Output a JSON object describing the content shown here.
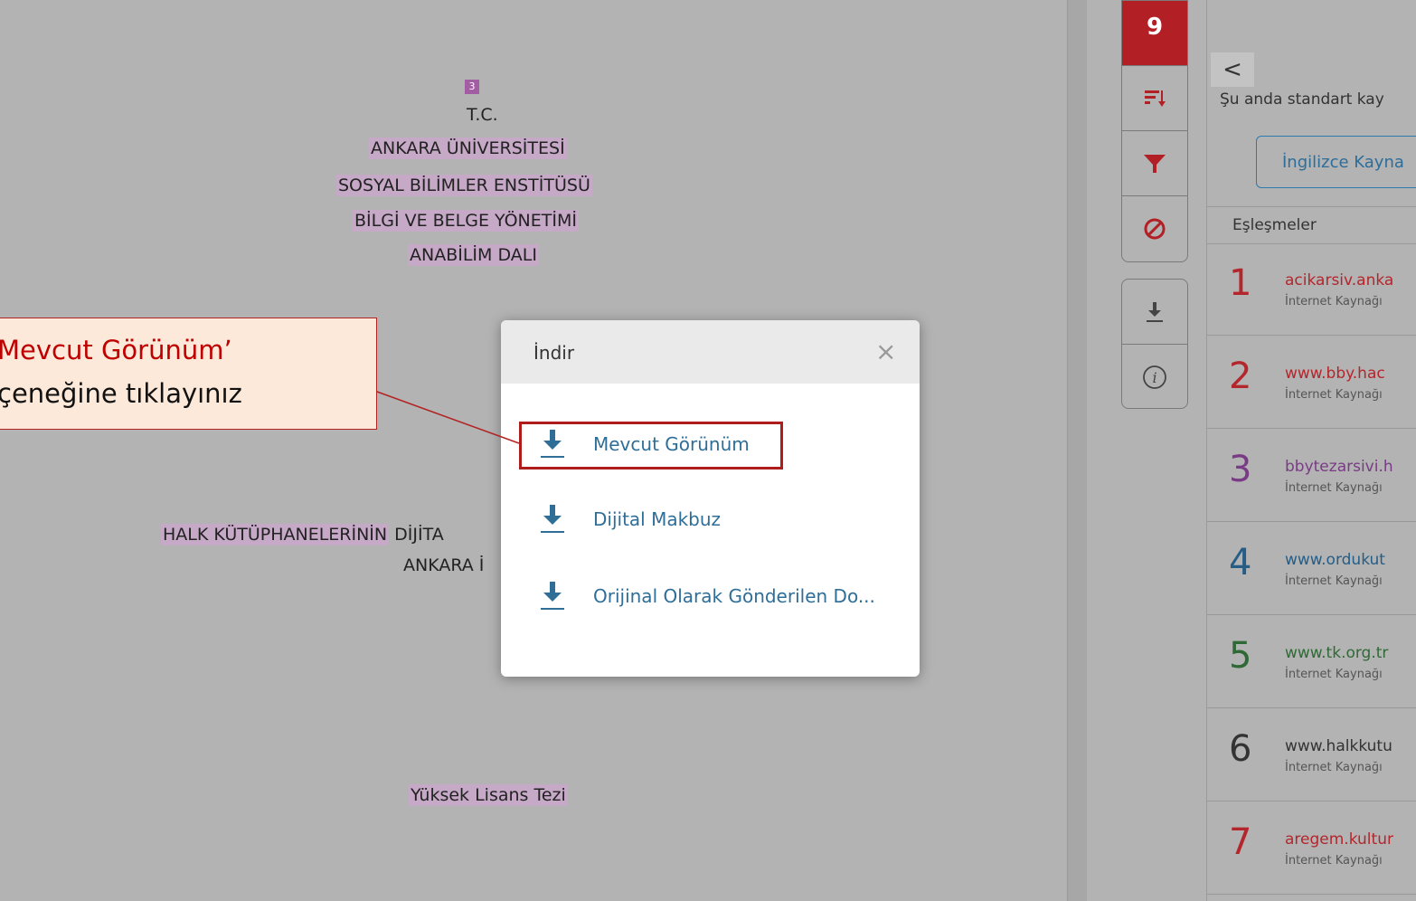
{
  "document": {
    "page_marker": "3",
    "lines": [
      "T.C.",
      "ANKARA ÜNİVERSİTESİ",
      "SOSYAL BİLİMLER ENSTİTÜSÜ",
      "BİLGİ VE BELGE YÖNETİMİ",
      "ANABİLİM DALI"
    ],
    "title_hl": "HALK KÜTÜPHANELERİNİN",
    "title_rest": "DİJİTA",
    "title_line2": "ANKARA İ",
    "degree": "Yüksek Lisans Tezi"
  },
  "toolbar": {
    "match_count": "9",
    "icons": [
      "sort-icon",
      "filter-icon",
      "exclude-icon",
      "download-icon",
      "info-icon"
    ]
  },
  "panel": {
    "back_label": "<",
    "standard_text": "Şu anda standart kay",
    "english_button": "İngilizce Kayna",
    "matches_header": "Eşleşmeler",
    "matches": [
      {
        "num": "1",
        "url": "acikarsiv.anka",
        "source": "İnternet Kaynağı",
        "color": "#b3262c"
      },
      {
        "num": "2",
        "url": "www.bby.hac",
        "source": "İnternet Kaynağı",
        "color": "#b3262c"
      },
      {
        "num": "3",
        "url": "bbytezarsivi.h",
        "source": "İnternet Kaynağı",
        "color": "#7a3b86"
      },
      {
        "num": "4",
        "url": "www.ordukut",
        "source": "İnternet Kaynağı",
        "color": "#255d86"
      },
      {
        "num": "5",
        "url": "www.tk.org.tr",
        "source": "İnternet Kaynağı",
        "color": "#2f6a36"
      },
      {
        "num": "6",
        "url": "www.halkkutu",
        "source": "İnternet Kaynağı",
        "color": "#333333"
      },
      {
        "num": "7",
        "url": "aregem.kultur",
        "source": "İnternet Kaynağı",
        "color": "#b3262c"
      }
    ]
  },
  "modal": {
    "title": "İndir",
    "close": "×",
    "options": [
      "Mevcut Görünüm",
      "Dijital Makbuz",
      "Orijinal Olarak Gönderilen Do..."
    ]
  },
  "callout": {
    "line1": "Mevcut Görünüm’",
    "line2": "çeneğine  tıklayınız"
  },
  "colors": {
    "accent_red": "#b21f24",
    "link_blue": "#2e6e97",
    "highlight_purple": "#c6a9c6"
  }
}
